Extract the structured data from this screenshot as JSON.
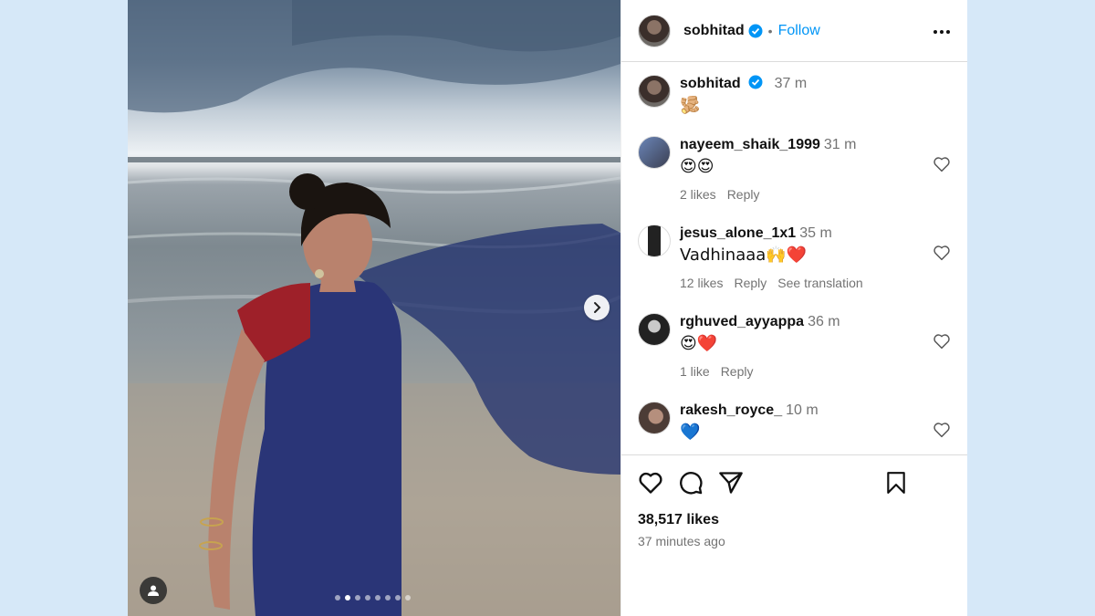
{
  "post": {
    "author": "sobhitad",
    "follow_label": "Follow",
    "separator": "•",
    "caption_time": "37 m",
    "caption_text": "🫚",
    "carousel": {
      "slides": 8,
      "active_index": 1
    }
  },
  "comments": [
    {
      "user": "nayeem_shaik_1999",
      "time": "31 m",
      "text": "😍😍",
      "likes": "2 likes",
      "reply": "Reply",
      "translation": ""
    },
    {
      "user": "jesus_alone_1x1",
      "time": "35 m",
      "text": "Vadhinaaa🙌❤️",
      "likes": "12 likes",
      "reply": "Reply",
      "translation": "See translation"
    },
    {
      "user": "rghuved_ayyappa",
      "time": "36 m",
      "text": "😍❤️",
      "likes": "1 like",
      "reply": "Reply",
      "translation": ""
    },
    {
      "user": "rakesh_royce_",
      "time": "10 m",
      "text": "💙",
      "likes": "",
      "reply": "",
      "translation": ""
    }
  ],
  "footer": {
    "likes_count": "38,517 likes",
    "time_ago": "37 minutes ago"
  },
  "colors": {
    "accent": "#0095f6",
    "verified": "#0095f6",
    "muted": "#737373"
  },
  "icons": [
    "verified-icon",
    "more-icon",
    "heart-icon",
    "comment-icon",
    "share-icon",
    "bookmark-icon",
    "chevron-right-icon",
    "user-tag-icon"
  ]
}
